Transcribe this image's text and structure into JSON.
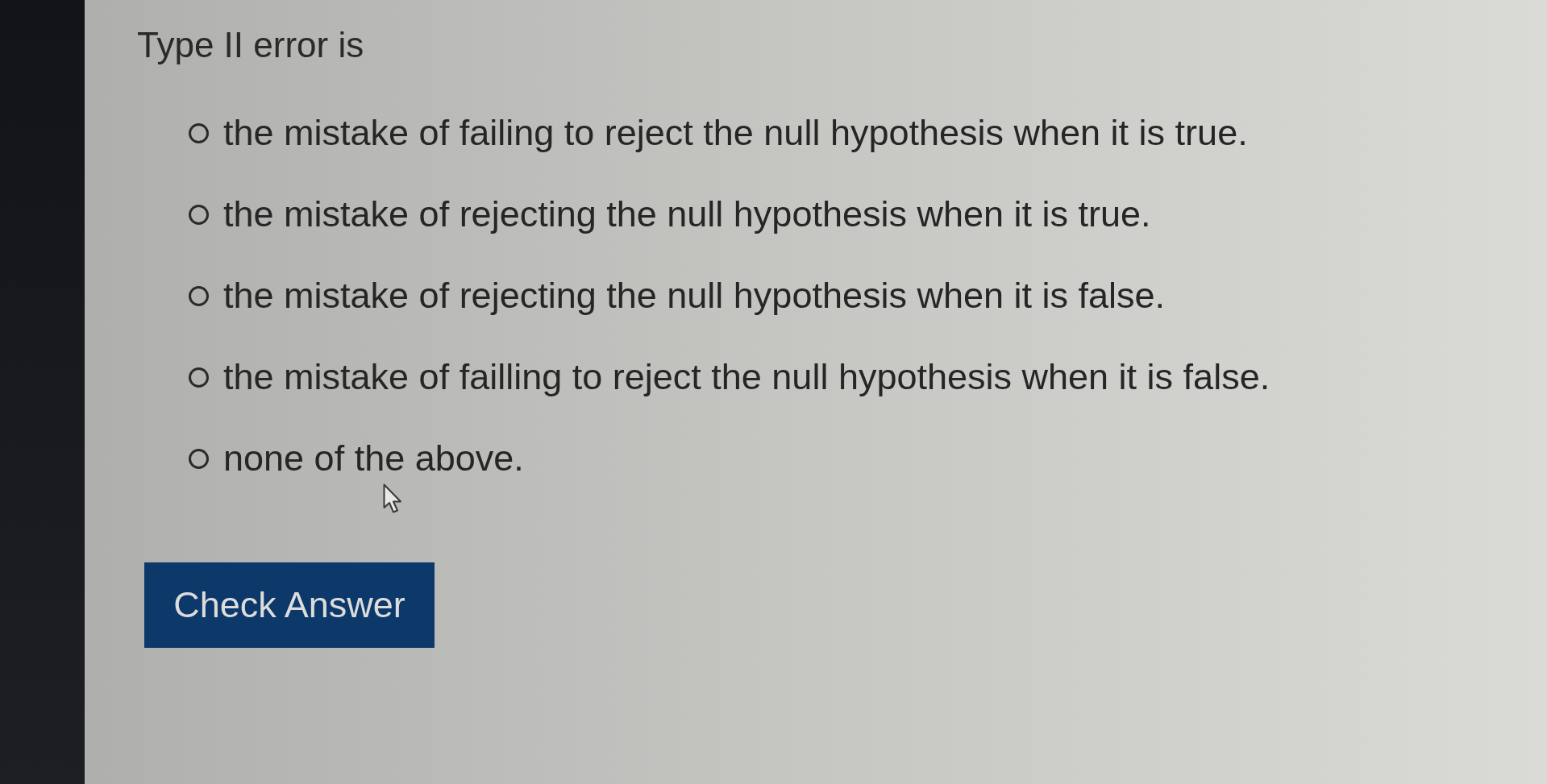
{
  "question": {
    "text": "Type II error is"
  },
  "options": [
    {
      "label": "the mistake of failing to reject the null hypothesis when it is true.",
      "selected": false
    },
    {
      "label": "the mistake of rejecting the null hypothesis when it is true.",
      "selected": false
    },
    {
      "label": "the mistake of rejecting the null hypothesis when it is false.",
      "selected": false
    },
    {
      "label": "the mistake of failling to reject the null hypothesis when it is false.",
      "selected": false
    },
    {
      "label": "none of the above.",
      "selected": false
    }
  ],
  "button": {
    "label": "Check Answer"
  }
}
